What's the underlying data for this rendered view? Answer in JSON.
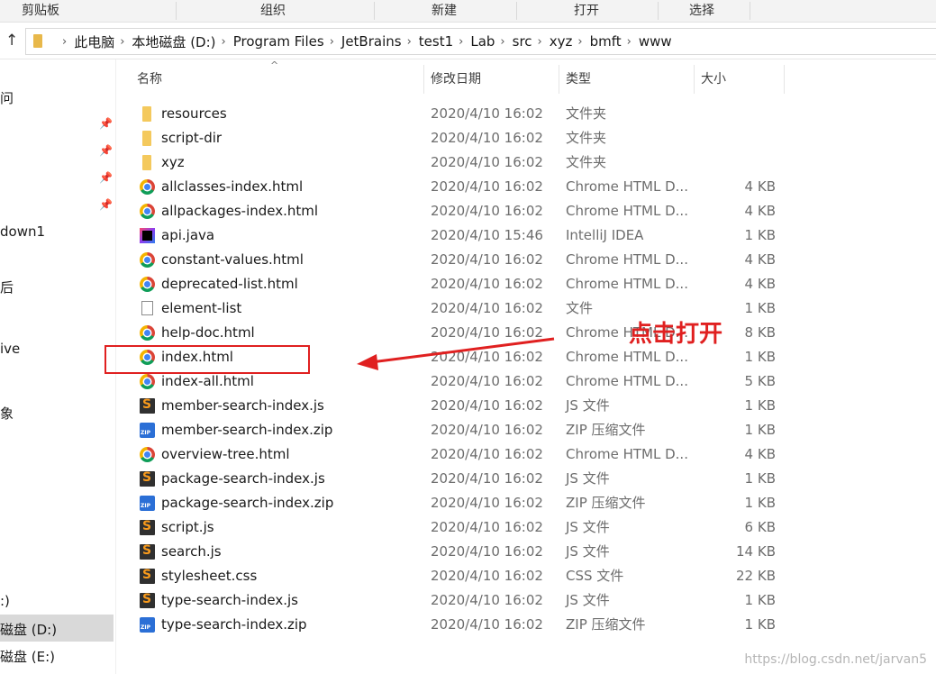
{
  "ribbon": {
    "groups": [
      "剪贴板",
      "组织",
      "新建",
      "打开",
      "选择"
    ]
  },
  "address": {
    "up_icon": "arrow-up",
    "crumbs": [
      "此电脑",
      "本地磁盘 (D:)",
      "Program Files",
      "JetBrains",
      "test1",
      "Lab",
      "src",
      "xyz",
      "bmft",
      "www"
    ]
  },
  "nav": {
    "items": [
      "问",
      "down1",
      "后",
      "ive",
      "象",
      ":)",
      "磁盘 (D:)",
      "磁盘 (E:)"
    ]
  },
  "columns": {
    "name": "名称",
    "date": "修改日期",
    "type": "类型",
    "size": "大小"
  },
  "files": [
    {
      "icon": "folder",
      "name": "resources",
      "date": "2020/4/10 16:02",
      "type": "文件夹",
      "size": ""
    },
    {
      "icon": "folder",
      "name": "script-dir",
      "date": "2020/4/10 16:02",
      "type": "文件夹",
      "size": ""
    },
    {
      "icon": "folder",
      "name": "xyz",
      "date": "2020/4/10 16:02",
      "type": "文件夹",
      "size": ""
    },
    {
      "icon": "chrome",
      "name": "allclasses-index.html",
      "date": "2020/4/10 16:02",
      "type": "Chrome HTML D...",
      "size": "4 KB"
    },
    {
      "icon": "chrome",
      "name": "allpackages-index.html",
      "date": "2020/4/10 16:02",
      "type": "Chrome HTML D...",
      "size": "4 KB"
    },
    {
      "icon": "intellij",
      "name": "api.java",
      "date": "2020/4/10 15:46",
      "type": "IntelliJ IDEA",
      "size": "1 KB"
    },
    {
      "icon": "chrome",
      "name": "constant-values.html",
      "date": "2020/4/10 16:02",
      "type": "Chrome HTML D...",
      "size": "4 KB"
    },
    {
      "icon": "chrome",
      "name": "deprecated-list.html",
      "date": "2020/4/10 16:02",
      "type": "Chrome HTML D...",
      "size": "4 KB"
    },
    {
      "icon": "file",
      "name": "element-list",
      "date": "2020/4/10 16:02",
      "type": "文件",
      "size": "1 KB"
    },
    {
      "icon": "chrome",
      "name": "help-doc.html",
      "date": "2020/4/10 16:02",
      "type": "Chrome HTML D...",
      "size": "8 KB"
    },
    {
      "icon": "chrome",
      "name": "index.html",
      "date": "2020/4/10 16:02",
      "type": "Chrome HTML D...",
      "size": "1 KB"
    },
    {
      "icon": "chrome",
      "name": "index-all.html",
      "date": "2020/4/10 16:02",
      "type": "Chrome HTML D...",
      "size": "5 KB"
    },
    {
      "icon": "js",
      "name": "member-search-index.js",
      "date": "2020/4/10 16:02",
      "type": "JS 文件",
      "size": "1 KB"
    },
    {
      "icon": "zip",
      "name": "member-search-index.zip",
      "date": "2020/4/10 16:02",
      "type": "ZIP 压缩文件",
      "size": "1 KB"
    },
    {
      "icon": "chrome",
      "name": "overview-tree.html",
      "date": "2020/4/10 16:02",
      "type": "Chrome HTML D...",
      "size": "4 KB"
    },
    {
      "icon": "js",
      "name": "package-search-index.js",
      "date": "2020/4/10 16:02",
      "type": "JS 文件",
      "size": "1 KB"
    },
    {
      "icon": "zip",
      "name": "package-search-index.zip",
      "date": "2020/4/10 16:02",
      "type": "ZIP 压缩文件",
      "size": "1 KB"
    },
    {
      "icon": "js",
      "name": "script.js",
      "date": "2020/4/10 16:02",
      "type": "JS 文件",
      "size": "6 KB"
    },
    {
      "icon": "js",
      "name": "search.js",
      "date": "2020/4/10 16:02",
      "type": "JS 文件",
      "size": "14 KB"
    },
    {
      "icon": "js",
      "name": "stylesheet.css",
      "date": "2020/4/10 16:02",
      "type": "CSS 文件",
      "size": "22 KB"
    },
    {
      "icon": "js",
      "name": "type-search-index.js",
      "date": "2020/4/10 16:02",
      "type": "JS 文件",
      "size": "1 KB"
    },
    {
      "icon": "zip",
      "name": "type-search-index.zip",
      "date": "2020/4/10 16:02",
      "type": "ZIP 压缩文件",
      "size": "1 KB"
    }
  ],
  "annotation": {
    "text": "点击打开",
    "color": "#e02020"
  },
  "watermark": "https://blog.csdn.net/jarvan5"
}
